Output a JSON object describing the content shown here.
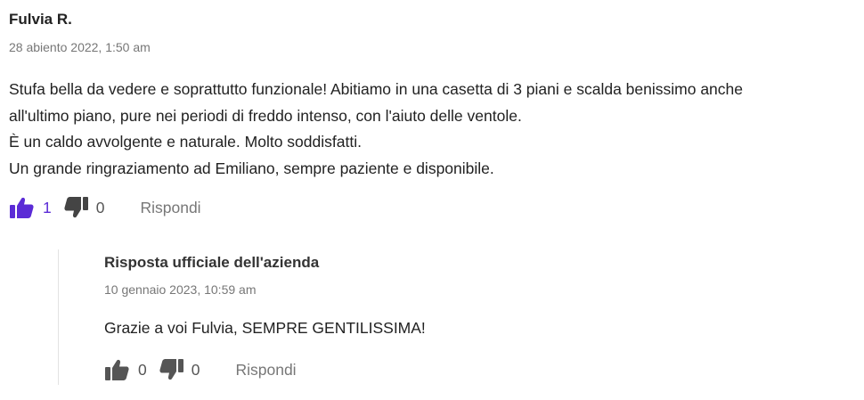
{
  "review": {
    "author": "Fulvia R.",
    "date": "28 abiento 2022, 1:50 am",
    "body_lines": [
      "Stufa bella da vedere e soprattutto funzionale! Abitiamo in una casetta di 3 piani e scalda benissimo anche",
      "all'ultimo piano, pure nei periodi di freddo intenso, con l'aiuto delle ventole.",
      "È un caldo avvolgente e naturale. Molto soddisfatti.",
      "Un grande ringraziamento ad Emiliano, sempre paziente e disponibile."
    ],
    "likes": "1",
    "dislikes": "0",
    "reply_label": "Rispondi",
    "like_icon": "thumbs-up-icon",
    "dislike_icon": "thumbs-down-icon",
    "like_color": "#5b2bd6"
  },
  "company_reply": {
    "author": "Risposta ufficiale dell'azienda",
    "date": "10 gennaio 2023, 10:59 am",
    "text": "Grazie a voi Fulvia, SEMPRE GENTILISSIMA!",
    "likes": "0",
    "dislikes": "0",
    "reply_label": "Rispondi",
    "icon_color": "#555555"
  }
}
